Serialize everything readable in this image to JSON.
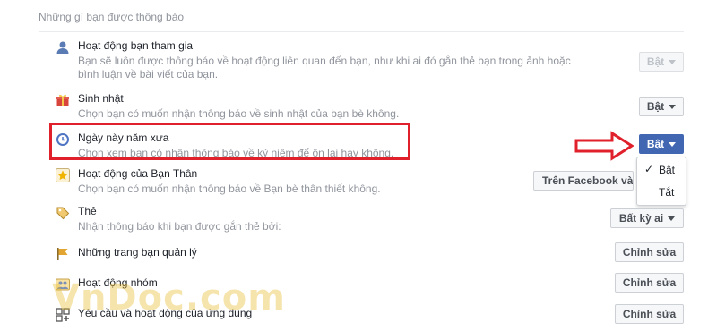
{
  "section": {
    "title": "Những gì bạn được thông báo"
  },
  "rows": [
    {
      "title": "Hoạt động bạn tham gia",
      "desc": "Bạn sẽ luôn được thông báo về hoạt động liên quan đến bạn, như khi ai đó gắn thẻ bạn trong ảnh hoặc bình luận về bài viết của bạn.",
      "button": "Bật",
      "icon": "person-icon"
    },
    {
      "title": "Sinh nhật",
      "desc": "Chọn bạn có muốn nhận thông báo về sinh nhật của bạn bè không.",
      "button": "Bật",
      "icon": "gift-icon"
    },
    {
      "title": "Ngày này năm xưa",
      "desc": "Chọn xem bạn có nhận thông báo về kỷ niệm để ôn lại hay không.",
      "button": "Bật",
      "icon": "clock-icon"
    },
    {
      "title": "Hoạt động của Bạn Thân",
      "desc": "Chọn bạn có muốn nhận thông báo về Bạn bè thân thiết không.",
      "button": "Trên Facebook và E",
      "icon": "star-icon"
    },
    {
      "title": "Thẻ",
      "desc": "Nhận thông báo khi bạn được gắn thẻ bởi:",
      "button": "Bất kỳ ai",
      "icon": "tag-icon"
    },
    {
      "title": "Những trang bạn quản lý",
      "button": "Chỉnh sửa",
      "icon": "flag-icon"
    },
    {
      "title": "Hoạt động nhóm",
      "button": "Chỉnh sửa",
      "icon": "group-icon"
    },
    {
      "title": "Yêu cầu và hoạt động của ứng dụng",
      "button": "Chỉnh sửa",
      "icon": "apps-icon"
    }
  ],
  "dropdown": {
    "options": [
      "Bật",
      "Tắt"
    ],
    "selected": "Bật"
  },
  "watermark": "VnDoc.com",
  "colors": {
    "accent": "#4267b2",
    "highlight": "#e0202a"
  }
}
